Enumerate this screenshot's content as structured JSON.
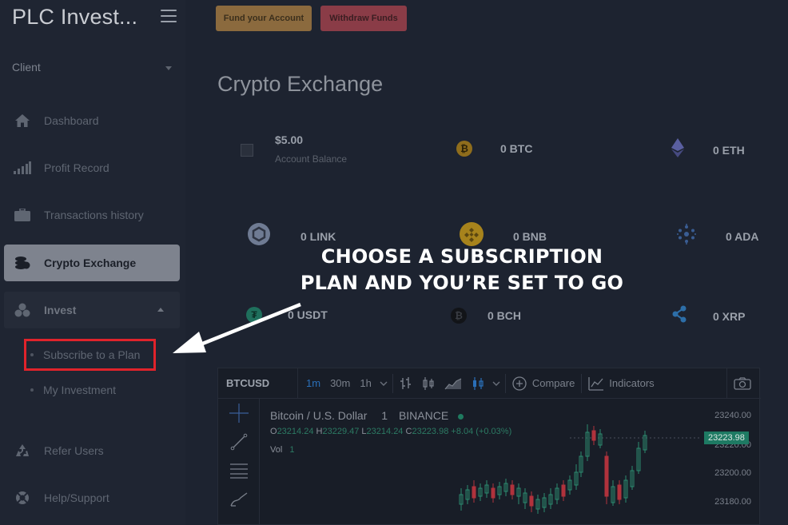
{
  "app": {
    "brand": "PLC Invest..."
  },
  "sidebar": {
    "client_label": "Client",
    "items": [
      {
        "label": "Dashboard",
        "icon": "home-icon"
      },
      {
        "label": "Profit Record",
        "icon": "bars-icon"
      },
      {
        "label": "Transactions history",
        "icon": "briefcase-icon"
      },
      {
        "label": "Crypto Exchange",
        "icon": "coins-icon"
      },
      {
        "label": "Invest",
        "icon": "cubes-icon"
      },
      {
        "label": "Refer Users",
        "icon": "recycle-icon"
      },
      {
        "label": "Help/Support",
        "icon": "lifebuoy-icon"
      }
    ],
    "sub_items": [
      {
        "label": "Subscribe to a Plan"
      },
      {
        "label": "My Investment"
      }
    ]
  },
  "topbar": {
    "fund_label": "Fund your Account",
    "withdraw_label": "Withdraw Funds"
  },
  "page": {
    "title": "Crypto Exchange"
  },
  "balances": {
    "account": {
      "amount": "$5.00",
      "label": "Account Balance"
    },
    "coins": [
      {
        "symbol": "BTC",
        "amount": "0 BTC",
        "color": "#a07a1e"
      },
      {
        "symbol": "ETH",
        "amount": "0 ETH",
        "color": "#5a5fa0"
      },
      {
        "symbol": "LINK",
        "amount": "0 LINK",
        "color": "#6f7b93"
      },
      {
        "symbol": "BNB",
        "amount": "0 BNB",
        "color": "#a7831c"
      },
      {
        "symbol": "ADA",
        "amount": "0 ADA",
        "color": "#2f4f80"
      },
      {
        "symbol": "USDT",
        "amount": "0 USDT",
        "color": "#1f6f5c"
      },
      {
        "symbol": "BCH",
        "amount": "0 BCH",
        "color": "#1a1a1a"
      },
      {
        "symbol": "XRP",
        "amount": "0 XRP",
        "color": "#2d6ea8"
      }
    ]
  },
  "callout": {
    "line1": "CHOOSE A SUBSCRIPTION",
    "line2": "PLAN AND YOU’RE SET TO GO"
  },
  "chart": {
    "symbol": "BTCUSD",
    "intervals": [
      "1m",
      "30m",
      "1h"
    ],
    "active_interval": "1m",
    "compare_label": "Compare",
    "indicators_label": "Indicators",
    "title": "Bitcoin / U.S. Dollar",
    "interval_label": "1",
    "exchange": "BINANCE",
    "ohlc": {
      "o_label": "O",
      "o": "23214.24",
      "h_label": "H",
      "h": "23229.47",
      "l_label": "L",
      "l": "23214.24",
      "c_label": "C",
      "c": "23223.98",
      "change": "+8.04 (+0.03%)"
    },
    "vol_label": "Vol",
    "vol_value": "1",
    "price_ticks": [
      "23240.00",
      "23220.00",
      "23200.00",
      "23180.00"
    ],
    "current_price": "23223.98",
    "colors": {
      "up": "#2c8a6f",
      "down": "#b0323c"
    }
  }
}
